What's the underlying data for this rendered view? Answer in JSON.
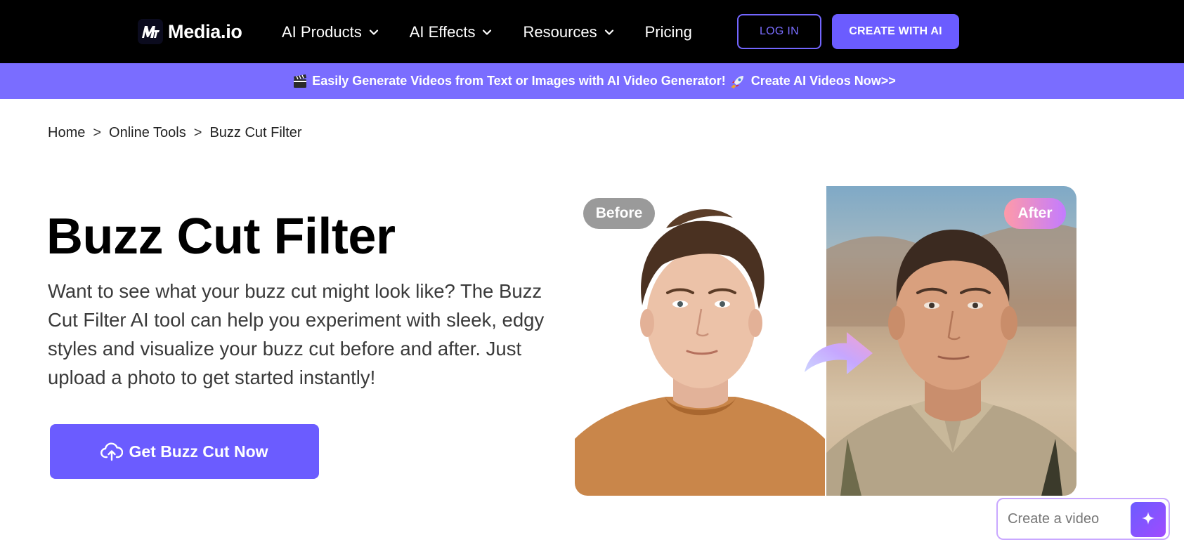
{
  "nav": {
    "logo_text": "Media.io",
    "items": [
      {
        "label": "AI Products",
        "has_dropdown": true,
        "icon": "chevron-down-icon"
      },
      {
        "label": "AI Effects",
        "has_dropdown": true,
        "icon": "chevron-down-icon"
      },
      {
        "label": "Resources",
        "has_dropdown": true,
        "icon": "chevron-down-icon"
      },
      {
        "label": "Pricing",
        "has_dropdown": false
      }
    ],
    "login_label": "LOG IN",
    "create_label": "CREATE WITH AI"
  },
  "promo": {
    "text": "Easily Generate Videos from Text or Images with AI Video Generator!",
    "link_text": "Create AI Videos Now>>",
    "icons": [
      "clapperboard-icon",
      "rocket-icon"
    ]
  },
  "breadcrumb": {
    "items": [
      "Home",
      "Online Tools",
      "Buzz Cut Filter"
    ],
    "separator": ">"
  },
  "hero": {
    "title": "Buzz Cut Filter",
    "description": "Want to see what your buzz cut might look like? The Buzz Cut Filter AI tool can help you experiment with sleek, edgy styles and visualize your buzz cut before and after. Just upload a photo to get started instantly!",
    "cta_label": "Get Buzz Cut Now",
    "cta_icon": "cloud-upload-icon"
  },
  "compare": {
    "before_label": "Before",
    "after_label": "After"
  },
  "chat": {
    "placeholder": "Create a video",
    "send_icon": "sparkle-icon"
  },
  "colors": {
    "brand": "#6b5cff",
    "promo_bg": "#7a6dff",
    "nav_bg": "#000000"
  }
}
